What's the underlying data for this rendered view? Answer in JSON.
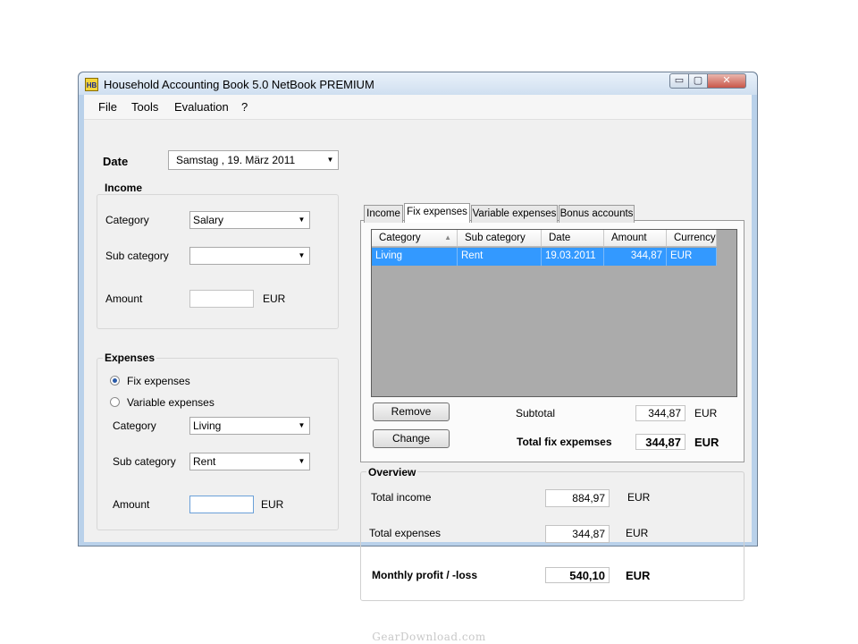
{
  "window": {
    "title": "Household Accounting Book 5.0 NetBook PREMIUM",
    "icon_text": "HB",
    "min_glyph": "▭",
    "max_glyph": "▢",
    "close_glyph": "✕"
  },
  "menu": [
    "File",
    "Tools",
    "Evaluation",
    "?"
  ],
  "date": {
    "label": "Date",
    "value": "Samstag  , 19.    März    2011"
  },
  "income": {
    "title": "Income",
    "category_label": "Category",
    "category_value": "Salary",
    "subcategory_label": "Sub category",
    "subcategory_value": "",
    "amount_label": "Amount",
    "amount_value": "",
    "currency": "EUR"
  },
  "expenses": {
    "title": "Expenses",
    "radio_fix": "Fix expenses",
    "radio_variable": "Variable expenses",
    "category_label": "Category",
    "category_value": "Living",
    "subcategory_label": "Sub category",
    "subcategory_value": "Rent",
    "amount_label": "Amount",
    "amount_value": "",
    "currency": "EUR"
  },
  "tabs": [
    "Income",
    "Fix expenses",
    "Variable expenses",
    "Bonus accounts"
  ],
  "active_tab": "Fix expenses",
  "grid": {
    "columns": [
      "Category",
      "Sub category",
      "Date",
      "Amount",
      "Currency"
    ],
    "rows": [
      {
        "category": "Living",
        "subcategory": "Rent",
        "date": "19.03.2011",
        "amount": "344,87",
        "currency": "EUR"
      }
    ]
  },
  "actions": {
    "remove": "Remove",
    "change": "Change"
  },
  "subtotal": {
    "label": "Subtotal",
    "value": "344,87",
    "currency": "EUR"
  },
  "total_fix": {
    "label": "Total fix expemses",
    "value": "344,87",
    "currency": "EUR"
  },
  "overview": {
    "title": "Overview",
    "income_label": "Total income",
    "income_value": "884,97",
    "income_currency": "EUR",
    "expenses_label": "Total expenses",
    "expenses_value": "344,87",
    "expenses_currency": "EUR",
    "profit_label": "Monthly profit / -loss",
    "profit_value": "540,10",
    "profit_currency": "EUR"
  },
  "watermark": "GearDownload.com",
  "colors": {
    "selection": "#3399ff",
    "grid_background": "#ababab",
    "title_bar": "#cfdff0"
  }
}
